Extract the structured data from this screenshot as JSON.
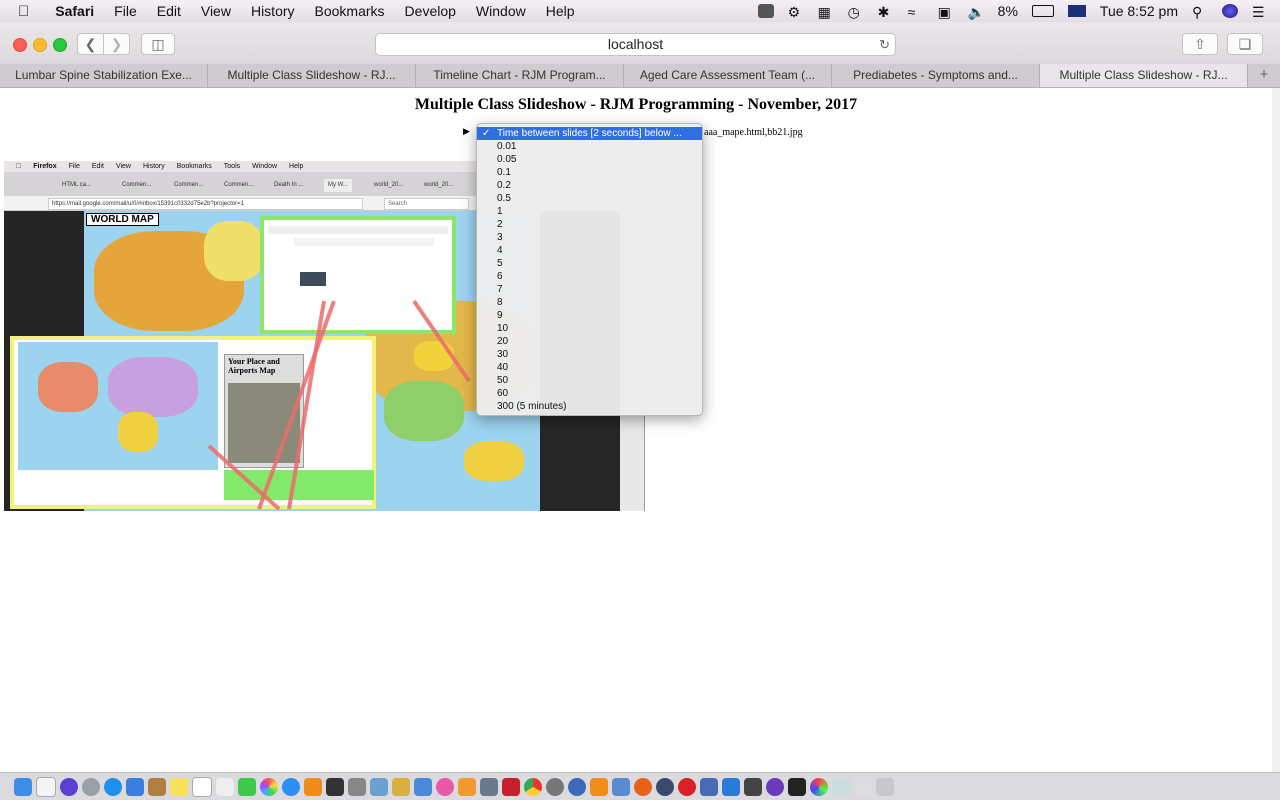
{
  "menubar": {
    "app_name": "Safari",
    "items": [
      "File",
      "Edit",
      "View",
      "History",
      "Bookmarks",
      "Develop",
      "Window",
      "Help"
    ],
    "battery": "8%",
    "clock": "Tue 8:52 pm"
  },
  "toolbar": {
    "url": "localhost"
  },
  "tabs": [
    {
      "label": "Lumbar Spine Stabilization Exe...",
      "active": false
    },
    {
      "label": "Multiple Class Slideshow - RJ...",
      "active": false
    },
    {
      "label": "Timeline Chart - RJM Program...",
      "active": false
    },
    {
      "label": "Aged Care Assessment Team (...",
      "active": false
    },
    {
      "label": "Prediabetes - Symptoms and...",
      "active": false
    },
    {
      "label": "Multiple Class Slideshow - RJ...",
      "active": true
    }
  ],
  "new_tab_label": "+",
  "page": {
    "title": "Multiple Class Slideshow - RJM Programming - November, 2017",
    "file_text": "aaa_mape.html,bb21.jpg"
  },
  "screenshot": {
    "menubar": [
      "Firefox",
      "File",
      "Edit",
      "View",
      "History",
      "Bookmarks",
      "Tools",
      "Window",
      "Help"
    ],
    "tabs": [
      "HTML ca...",
      "Commen...",
      "Commen...",
      "Commen...",
      "Death In ...",
      "My W...",
      "world_20...",
      "world_20..."
    ],
    "url": "https://mail.google.com/mail/u/0/#inbox/15391c0332d75e2b?projector=1",
    "search_placeholder": "Search",
    "map_label": "WORLD MAP",
    "places_title": "Your Place and Airports Map"
  },
  "dropdown": {
    "selected": "Time between slides [2 seconds] below ...",
    "options": [
      "0.01",
      "0.05",
      "0.1",
      "0.2",
      "0.5",
      "1",
      "2",
      "3",
      "4",
      "5",
      "6",
      "7",
      "8",
      "9",
      "10",
      "20",
      "30",
      "40",
      "50",
      "60",
      "300 (5 minutes)"
    ]
  },
  "colors": {
    "selection": "#2f6fe0",
    "inner_border_green": "#8be66a",
    "inner_border_yellow": "#f2f27a"
  }
}
